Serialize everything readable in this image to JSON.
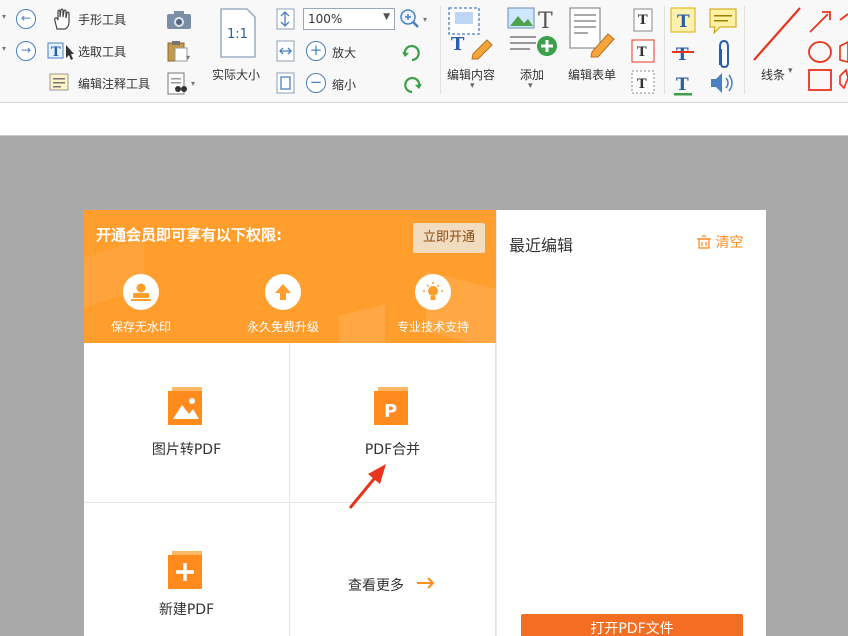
{
  "toolbar": {
    "hand_tool": "手形工具",
    "select_tool": "选取工具",
    "annotate_tool": "编辑注释工具",
    "actual_size": "实际大小",
    "zoom_value": "100%",
    "zoom_in": "放大",
    "zoom_out": "缩小",
    "edit_content": "编辑内容",
    "add": "添加",
    "edit_form": "编辑表单",
    "lines": "线条"
  },
  "banner": {
    "title": "开通会员即可享有以下权限:",
    "open_button": "立即开通",
    "perks": [
      {
        "label": "保存无水印",
        "icon": "stamp-icon"
      },
      {
        "label": "永久免费升级",
        "icon": "upgrade-arrow-icon"
      },
      {
        "label": "专业技术支持",
        "icon": "bulb-icon"
      }
    ]
  },
  "tools": [
    {
      "label": "图片转PDF",
      "icon": "image-to-pdf-icon"
    },
    {
      "label": "PDF合并",
      "icon": "pdf-merge-icon"
    },
    {
      "label": "新建PDF",
      "icon": "new-pdf-icon"
    },
    {
      "label": "查看更多",
      "icon": "arrow-right-icon"
    }
  ],
  "recent": {
    "title": "最近编辑",
    "clear": "清空",
    "open_file": "打开PDF文件"
  },
  "colors": {
    "brand_orange": "#ff9d2d",
    "action_orange": "#f36d22",
    "annotation_red": "#e8341c"
  }
}
